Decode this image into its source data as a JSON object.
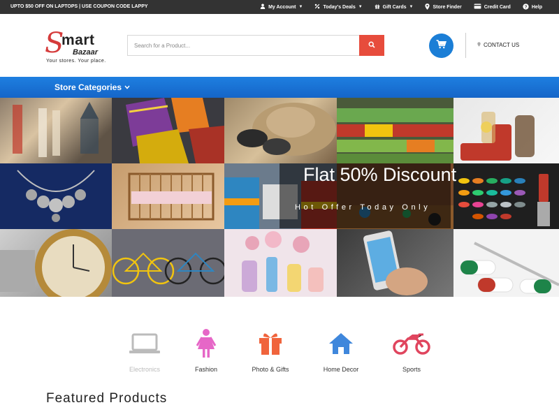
{
  "topbar": {
    "promo": "UPTO $50 OFF ON LAPTOPS | USE COUPON CODE LAPPY",
    "links": [
      {
        "label": "My Account",
        "icon": "user-icon",
        "caret": true
      },
      {
        "label": "Today's Deals",
        "icon": "percent-icon",
        "caret": true
      },
      {
        "label": "Gift Cards",
        "icon": "gift-icon",
        "caret": true
      },
      {
        "label": "Store Finder",
        "icon": "map-pin-icon",
        "caret": false
      },
      {
        "label": "Credit Card",
        "icon": "credit-card-icon",
        "caret": false
      },
      {
        "label": "Help",
        "icon": "question-circle-icon",
        "caret": false
      }
    ]
  },
  "header": {
    "logo_s": "S",
    "logo_mart": "mart",
    "logo_bazaar": "Bazaar",
    "tagline": "Your stores. Your place.",
    "search_placeholder": "Search for a Product...",
    "contact": "CONTACT US"
  },
  "catbar": {
    "label": "Store Categories"
  },
  "hero": {
    "title": "Flat 50% Discount",
    "subtitle": "Hot Offer Today Only"
  },
  "categories": [
    {
      "label": "Electronics",
      "icon": "laptop-icon",
      "color": "#bbbbbb"
    },
    {
      "label": "Fashion",
      "icon": "woman-icon",
      "color": "#e667c7"
    },
    {
      "label": "Photo & Gifts",
      "icon": "gift-icon",
      "color": "#f0643c"
    },
    {
      "label": "Home Decor",
      "icon": "home-icon",
      "color": "#3f87dc"
    },
    {
      "label": "Sports",
      "icon": "motorcycle-icon",
      "color": "#e0455e"
    }
  ],
  "featured_title": "Featured Products",
  "colors": {
    "topbar": "#333333",
    "accent_blue": "#1b7ed6",
    "search_button": "#e74c3c"
  }
}
